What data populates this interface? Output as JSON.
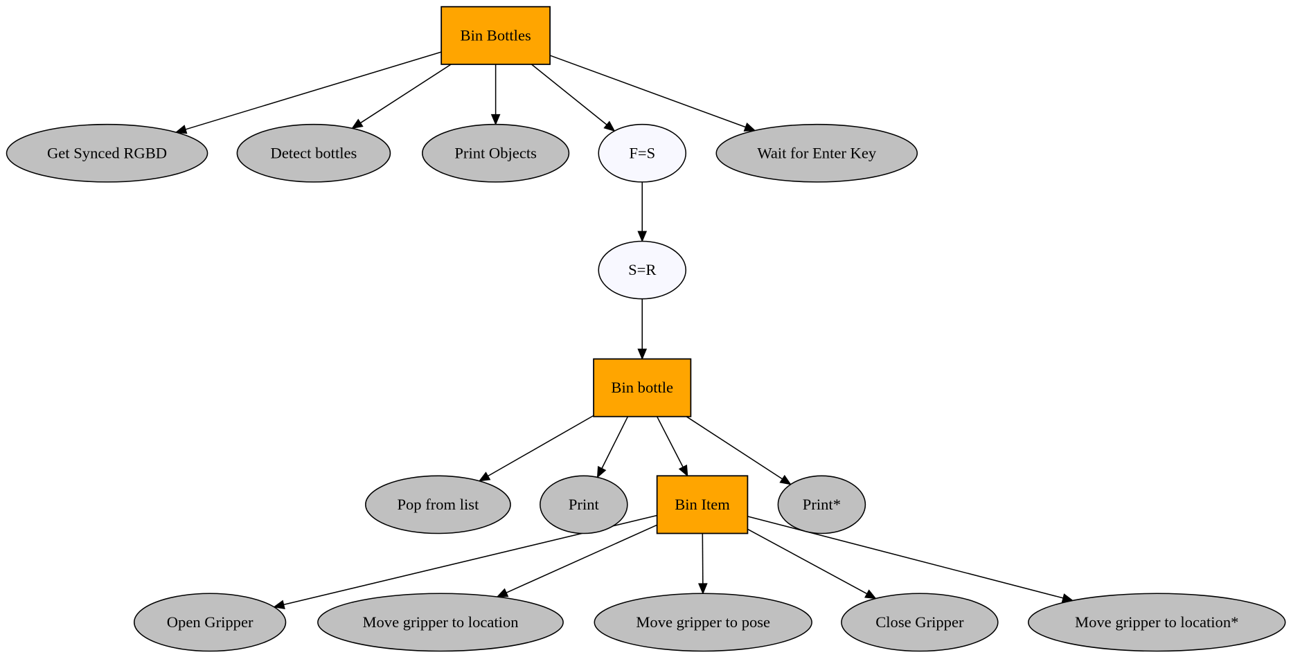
{
  "diagram": {
    "colors": {
      "composite": "#FFA500",
      "leaf": "#C0C0C0",
      "decorator": "#F8F8FF",
      "stroke": "#000000"
    },
    "nodes": [
      {
        "id": "bin_bottles",
        "label": "Bin Bottles",
        "shape": "box",
        "kind": "composite"
      },
      {
        "id": "get_synced",
        "label": "Get Synced RGBD",
        "shape": "ellipse",
        "kind": "leaf"
      },
      {
        "id": "detect",
        "label": "Detect bottles",
        "shape": "ellipse",
        "kind": "leaf"
      },
      {
        "id": "print_objects",
        "label": "Print Objects",
        "shape": "ellipse",
        "kind": "leaf"
      },
      {
        "id": "fs",
        "label": "F=S",
        "shape": "ellipse",
        "kind": "decorator"
      },
      {
        "id": "wait_enter",
        "label": "Wait for Enter Key",
        "shape": "ellipse",
        "kind": "leaf"
      },
      {
        "id": "sr",
        "label": "S=R",
        "shape": "ellipse",
        "kind": "decorator"
      },
      {
        "id": "bin_bottle",
        "label": "Bin bottle",
        "shape": "box",
        "kind": "composite"
      },
      {
        "id": "pop",
        "label": "Pop from list",
        "shape": "ellipse",
        "kind": "leaf"
      },
      {
        "id": "print",
        "label": "Print",
        "shape": "ellipse",
        "kind": "leaf"
      },
      {
        "id": "bin_item",
        "label": "Bin Item",
        "shape": "box",
        "kind": "composite"
      },
      {
        "id": "print_star",
        "label": "Print*",
        "shape": "ellipse",
        "kind": "leaf"
      },
      {
        "id": "open_gripper",
        "label": "Open Gripper",
        "shape": "ellipse",
        "kind": "leaf"
      },
      {
        "id": "move_loc",
        "label": "Move gripper to location",
        "shape": "ellipse",
        "kind": "leaf"
      },
      {
        "id": "move_pose",
        "label": "Move gripper to pose",
        "shape": "ellipse",
        "kind": "leaf"
      },
      {
        "id": "close_gripper",
        "label": "Close Gripper",
        "shape": "ellipse",
        "kind": "leaf"
      },
      {
        "id": "move_loc_star",
        "label": "Move gripper to location*",
        "shape": "ellipse",
        "kind": "leaf"
      }
    ],
    "edges": [
      {
        "from": "bin_bottles",
        "to": "get_synced"
      },
      {
        "from": "bin_bottles",
        "to": "detect"
      },
      {
        "from": "bin_bottles",
        "to": "print_objects"
      },
      {
        "from": "bin_bottles",
        "to": "fs"
      },
      {
        "from": "bin_bottles",
        "to": "wait_enter"
      },
      {
        "from": "fs",
        "to": "sr"
      },
      {
        "from": "sr",
        "to": "bin_bottle"
      },
      {
        "from": "bin_bottle",
        "to": "pop"
      },
      {
        "from": "bin_bottle",
        "to": "print"
      },
      {
        "from": "bin_bottle",
        "to": "bin_item"
      },
      {
        "from": "bin_bottle",
        "to": "print_star"
      },
      {
        "from": "bin_item",
        "to": "open_gripper"
      },
      {
        "from": "bin_item",
        "to": "move_loc"
      },
      {
        "from": "bin_item",
        "to": "move_pose"
      },
      {
        "from": "bin_item",
        "to": "close_gripper"
      },
      {
        "from": "bin_item",
        "to": "move_loc_star"
      }
    ]
  }
}
